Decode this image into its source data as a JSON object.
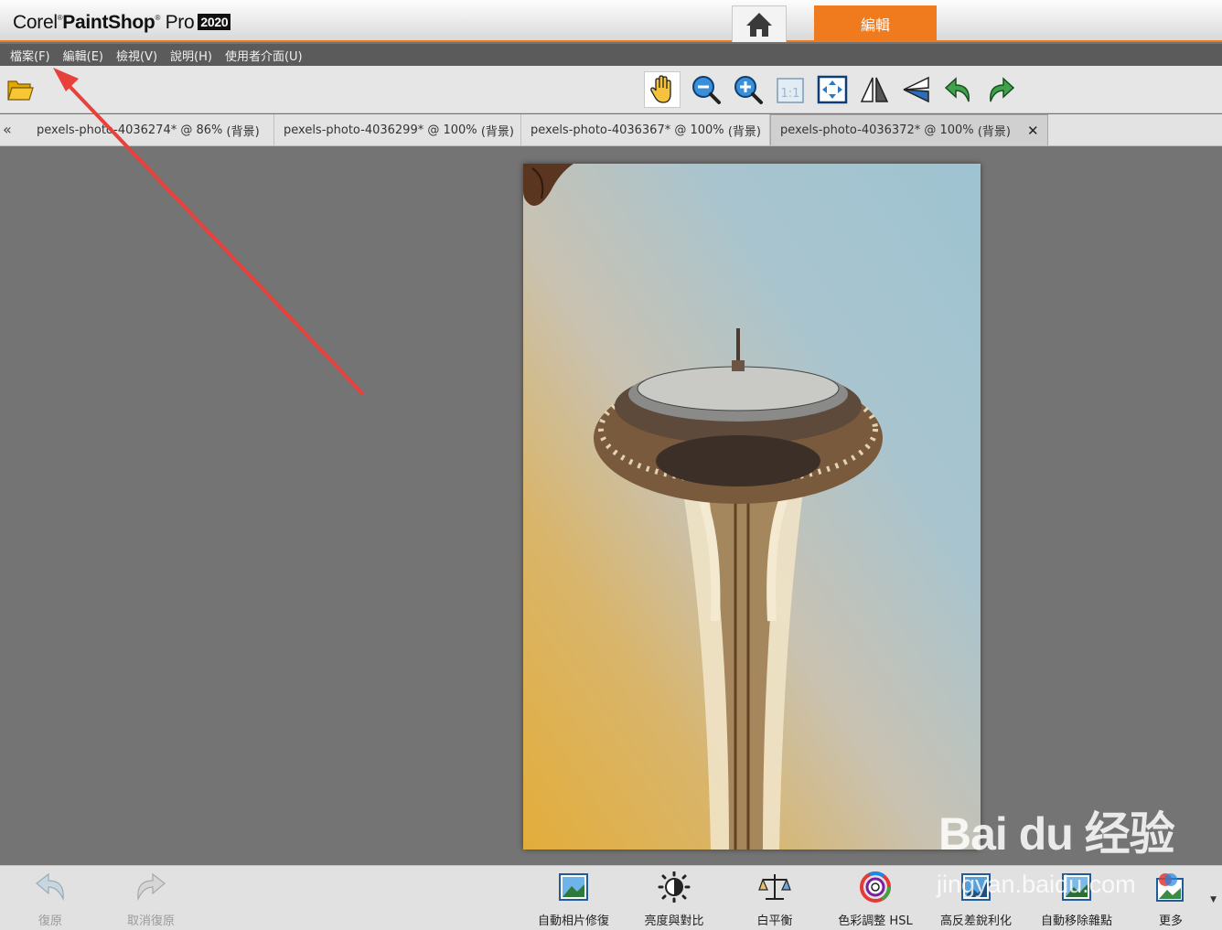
{
  "app": {
    "logo_corel": "Corel",
    "logo_product": "PaintShop",
    "logo_pro": "Pro",
    "logo_year": "2020",
    "edit_tab_label": "編輯"
  },
  "menu": [
    "檔案(F)",
    "編輯(E)",
    "檢視(V)",
    "說明(H)",
    "使用者介面(U)"
  ],
  "toolbar": {
    "icons": [
      "open-folder-icon",
      "pan-hand-icon",
      "zoom-out-icon",
      "zoom-in-icon",
      "actual-size-icon",
      "fit-window-icon",
      "flip-icon",
      "mirror-icon",
      "rotate-left-icon",
      "rotate-right-icon"
    ],
    "actual_size_text": "1:1"
  },
  "doc_tabs": [
    {
      "name": "pexels-photo-4036274*",
      "zoom": "@  86%",
      "layer": "(背景)"
    },
    {
      "name": "pexels-photo-4036299*",
      "zoom": "@ 100%",
      "layer": "(背景)"
    },
    {
      "name": "pexels-photo-4036367*",
      "zoom": "@ 100%",
      "layer": "(背景)"
    },
    {
      "name": "pexels-photo-4036372*",
      "zoom": "@ 100%",
      "layer": "(背景)",
      "active": true
    }
  ],
  "bottom": {
    "undo": "復原",
    "redo": "取消復原",
    "tools": [
      "自動相片修復",
      "亮度與對比",
      "白平衡",
      "色彩調整 HSL",
      "高反差銳利化",
      "自動移除雜點",
      "更多"
    ]
  },
  "watermark": {
    "logo": "Bai du 经验",
    "url": "jingyan.baidu.com"
  },
  "colors": {
    "accent": "#f07a1e",
    "menubar": "#5b5b5b",
    "canvas": "#747474",
    "annotation": "#e8403a"
  }
}
